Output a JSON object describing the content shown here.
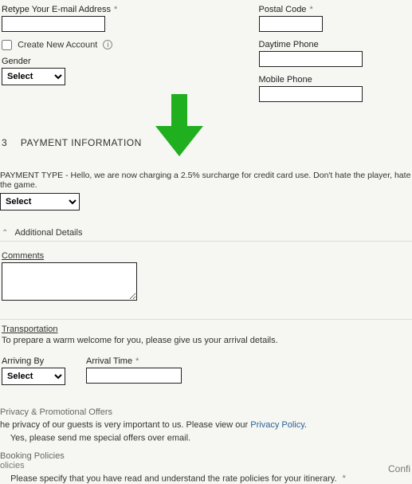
{
  "left": {
    "retype_email_label": "Retype Your E-mail Address",
    "create_account_label": "Create New Account",
    "gender_label": "Gender",
    "gender_select": "Select"
  },
  "right": {
    "postal_label": "Postal Code",
    "daytime_label": "Daytime Phone",
    "mobile_label": "Mobile Phone"
  },
  "section3": {
    "num": "3",
    "title": "PAYMENT INFORMATION",
    "payment_type_label": "PAYMENT TYPE - Hello, we are now charging a 2.5% surcharge for credit card use. Don't hate the player, hate the game.",
    "payment_select": "Select"
  },
  "additional": {
    "header": "Additional Details",
    "comments_label": "Comments"
  },
  "transport": {
    "header": "Transportation",
    "note": "To prepare a warm welcome for you, please give us your arrival details.",
    "arriving_label": "Arriving By",
    "arriving_select": "Select",
    "arrival_time_label": "Arrival Time"
  },
  "privacy": {
    "header": "Privacy & Promotional Offers",
    "text_pre": "he privacy of our guests is very important to us. Please view our ",
    "link": "Privacy Policy",
    "text_post": ".",
    "checkbox_label": "Yes, please send me special offers over email."
  },
  "booking": {
    "header": "Booking Policies",
    "sub": "olicies",
    "checkbox_label": "Please specify that you have read and understand the rate policies for your itinerary."
  },
  "confirm": "Confi"
}
